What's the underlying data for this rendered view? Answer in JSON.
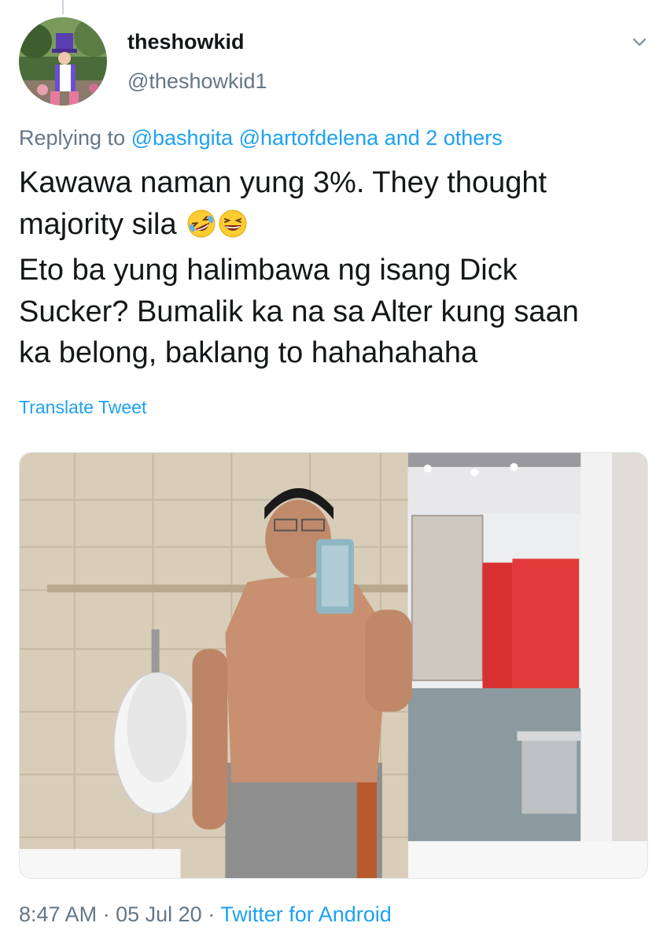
{
  "tweet": {
    "display_name": "theshowkid",
    "handle": "@theshowkid1",
    "reply": {
      "prefix": "Replying to",
      "mentions": [
        "@bashgita",
        "@hartofdelena"
      ],
      "suffix": "and 2 others"
    },
    "text_line1": "Kawawa naman yung 3%. They thought",
    "text_line2": "majority sila",
    "text_rest": "Eto ba yung halimbawa ng isang Dick\nSucker? Bumalik ka na sa Alter kung saan\nka belong, baklang to hahahahaha",
    "emojis": [
      "rolling-on-floor-laughing",
      "grinning-squinting"
    ],
    "translate_label": "Translate Tweet",
    "time": "8:47 AM",
    "separator": "·",
    "date": "05 Jul 20",
    "source": "Twitter for Android"
  },
  "icons": {
    "caret": "chevron-down-icon"
  },
  "colors": {
    "link": "#1da1f2",
    "secondary_text": "#657786",
    "primary_text": "#14171a"
  }
}
